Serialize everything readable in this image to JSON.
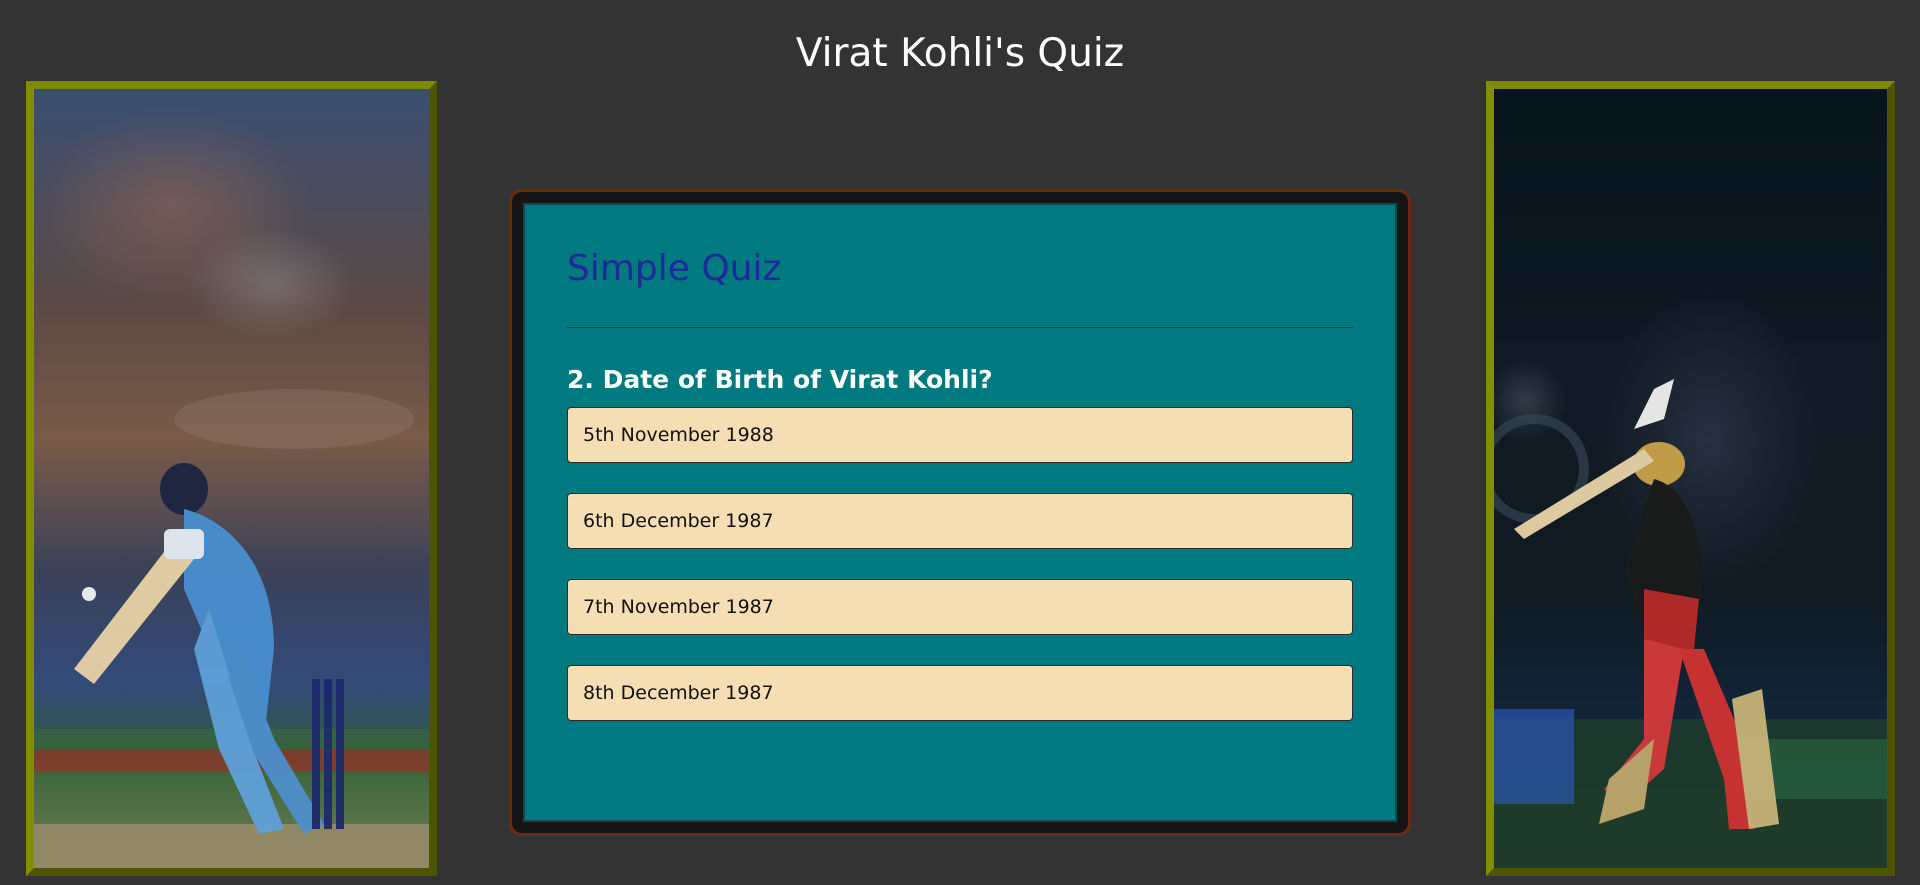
{
  "page": {
    "title": "Virat Kohli's Quiz"
  },
  "quiz": {
    "heading": "Simple Quiz",
    "question": "2. Date of Birth of Virat Kohli?",
    "options": [
      "5th November 1988",
      "6th December 1987",
      "7th November 1987",
      "8th December 1987"
    ]
  },
  "colors": {
    "page_background": "#333333",
    "card_background": "#007a80",
    "heading": "#1f2a9a",
    "option_background": "#f5deb3",
    "frame": "#6f7a00"
  }
}
